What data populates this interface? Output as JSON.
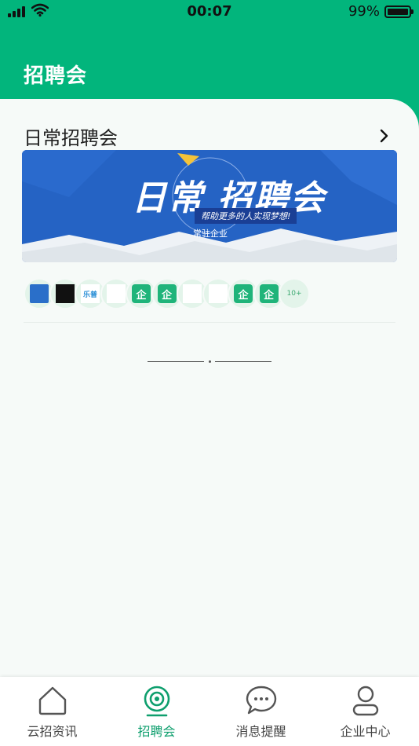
{
  "status_bar": {
    "time": "00:07",
    "battery": "99%"
  },
  "header": {
    "title": "招聘会"
  },
  "section": {
    "title": "日常招聘会",
    "banner": {
      "title": "日常 招聘会",
      "subtitle": "帮助更多的人实现梦想!",
      "caption": "常驻企业"
    },
    "logos": [
      {
        "icon": "company-logo-blue",
        "text": ""
      },
      {
        "icon": "company-logo-black",
        "text": ""
      },
      {
        "icon": "company-logo-legu",
        "text": "乐普"
      },
      {
        "icon": "company-logo-rainbow",
        "text": ""
      },
      {
        "icon": "company-enterprise-icon",
        "text": "企"
      },
      {
        "icon": "company-enterprise-icon",
        "text": "企"
      },
      {
        "icon": "company-logo-brand",
        "text": ""
      },
      {
        "icon": "company-logo-hotel",
        "text": ""
      },
      {
        "icon": "company-enterprise-icon",
        "text": "企"
      },
      {
        "icon": "company-enterprise-icon",
        "text": "企"
      }
    ],
    "more_count": "10+"
  },
  "tabs": [
    {
      "label": "云招资讯",
      "icon": "home-icon",
      "active": false
    },
    {
      "label": "招聘会",
      "icon": "camera-icon",
      "active": true
    },
    {
      "label": "消息提醒",
      "icon": "chat-icon",
      "active": false
    },
    {
      "label": "企业中心",
      "icon": "user-icon",
      "active": false
    }
  ],
  "colors": {
    "brand": "#02b57c",
    "active_tab": "#0f9f6e",
    "banner_blue": "#2563c4"
  }
}
